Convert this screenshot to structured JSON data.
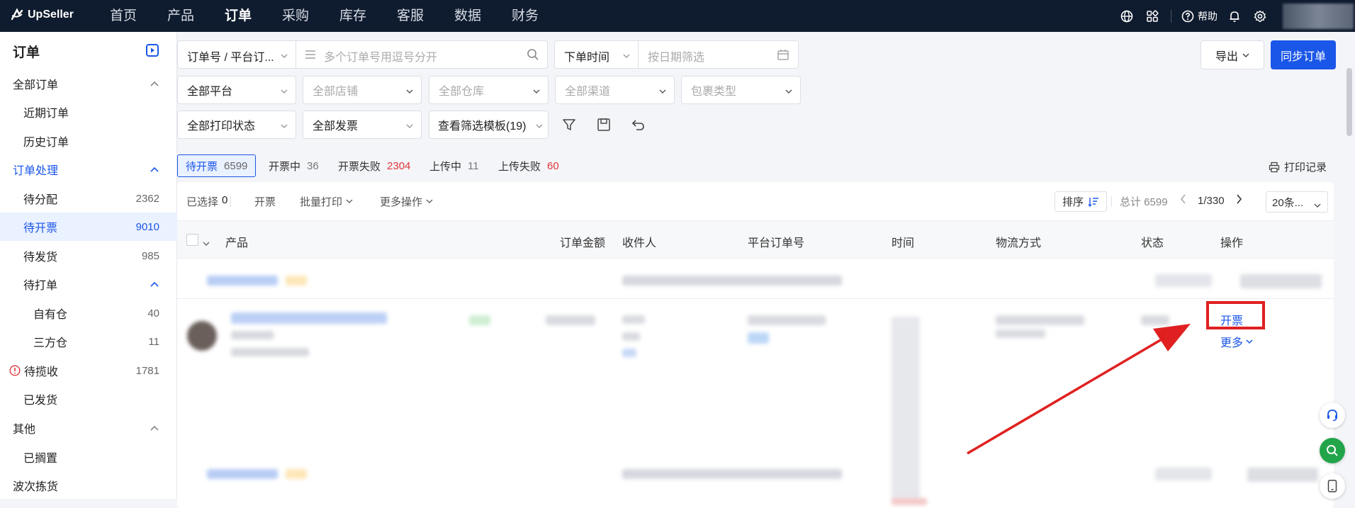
{
  "topbar": {
    "logo_text": "UpSeller",
    "nav": [
      "首页",
      "产品",
      "订单",
      "采购",
      "库存",
      "客服",
      "数据",
      "财务"
    ],
    "active_nav": "订单",
    "help_label": "帮助"
  },
  "sidebar": {
    "title": "订单",
    "items": [
      {
        "label": "全部订单",
        "count": "",
        "level": 0,
        "expanded": true
      },
      {
        "label": "近期订单",
        "count": "",
        "level": 1
      },
      {
        "label": "历史订单",
        "count": "",
        "level": 1
      },
      {
        "label": "订单处理",
        "count": "",
        "level": 0,
        "expanded": true,
        "color": "blue"
      },
      {
        "label": "待分配",
        "count": "2362",
        "level": 1
      },
      {
        "label": "待开票",
        "count": "9010",
        "level": 1,
        "selected": true
      },
      {
        "label": "待发货",
        "count": "985",
        "level": 1
      },
      {
        "label": "待打单",
        "count": "",
        "level": 1,
        "expanded": true
      },
      {
        "label": "自有仓",
        "count": "40",
        "level": 2
      },
      {
        "label": "三方仓",
        "count": "11",
        "level": 2
      },
      {
        "label": "待揽收",
        "count": "1781",
        "level": 1,
        "warning": true
      },
      {
        "label": "已发货",
        "count": "",
        "level": 1
      },
      {
        "label": "其他",
        "count": "",
        "level": 0,
        "expanded": true
      },
      {
        "label": "已搁置",
        "count": "",
        "level": 1
      },
      {
        "label": "波次拣货",
        "count": "",
        "level": 0
      }
    ]
  },
  "filters": {
    "search_type": "订单号 / 平台订...",
    "search_placeholder": "多个订单号用逗号分开",
    "time_type": "下单时间",
    "date_placeholder": "按日期筛选",
    "platform": "全部平台",
    "store_placeholder": "全部店铺",
    "warehouse_placeholder": "全部仓库",
    "channel_placeholder": "全部渠道",
    "package_placeholder": "包裹类型",
    "print_status": "全部打印状态",
    "invoice": "全部发票",
    "template": "查看筛选模板(19)"
  },
  "actions": {
    "export_label": "导出",
    "sync_label": "同步订单",
    "print_record_label": "打印记录"
  },
  "status_tabs": [
    {
      "label": "待开票",
      "count": "6599",
      "selected": true,
      "count_color": "normal"
    },
    {
      "label": "开票中",
      "count": "36",
      "count_color": "normal"
    },
    {
      "label": "开票失败",
      "count": "2304",
      "count_color": "red"
    },
    {
      "label": "上传中",
      "count": "11",
      "count_color": "normal"
    },
    {
      "label": "上传失败",
      "count": "60",
      "count_color": "red"
    }
  ],
  "toolbar": {
    "selected_label": "已选择",
    "selected_count": "0",
    "invoice_label": "开票",
    "batch_print_label": "批量打印",
    "more_ops_label": "更多操作",
    "sort_label": "排序",
    "total_label": "总计 6599",
    "page": "1/330",
    "page_size": "20条..."
  },
  "table": {
    "columns": [
      "产品",
      "订单金额",
      "收件人",
      "平台订单号",
      "时间",
      "物流方式",
      "状态",
      "操作"
    ]
  },
  "row_actions": {
    "invoice": "开票",
    "more": "更多"
  },
  "colors": {
    "brand": "#1a56e8",
    "topbar": "#0f1b2e",
    "error": "#e0353a",
    "annotation": "#e02020"
  }
}
